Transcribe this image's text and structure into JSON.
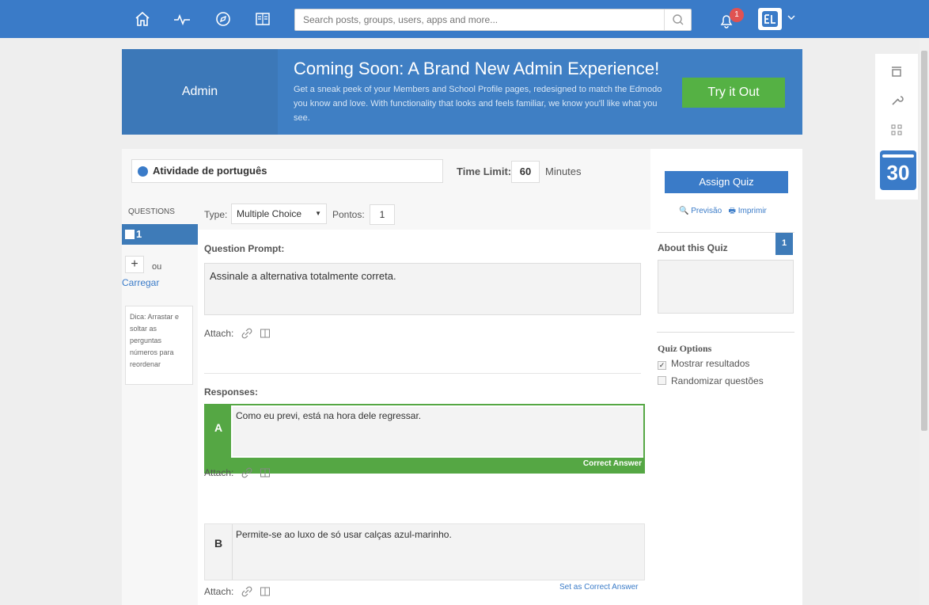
{
  "topbar": {
    "search_placeholder": "Search posts, groups, users, apps and more...",
    "notification_count": "1",
    "icons": [
      "home-icon",
      "activity-icon",
      "discover-icon",
      "library-icon",
      "search-icon",
      "bell-icon",
      "avatar",
      "chevron-down-icon"
    ]
  },
  "banner": {
    "left_label": "Admin",
    "title": "Coming Soon: A Brand New Admin Experience!",
    "description": "Get a sneak peek of your Members and School Profile pages, redesigned to match the Edmodo you know and love. With functionality that looks and feels familiar, we know you'll like what you see.",
    "button": "Try it Out"
  },
  "rail": {
    "icons": [
      "store-icon",
      "wrench-icon",
      "grid-icon"
    ],
    "calendar_day": "30"
  },
  "quiz": {
    "title": "Atividade de português",
    "time_limit_label": "Time Limit:",
    "time_limit_value": "60",
    "time_limit_unit": "Minutes"
  },
  "questions": {
    "header": "QUESTIONS",
    "items": [
      "1"
    ],
    "add_label": "+",
    "or_label": "ou",
    "upload_label": "Carregar",
    "tip": "Dica: Arrastar e soltar as perguntas números para reordenar"
  },
  "editor": {
    "type_label": "Type:",
    "type_value": "Multiple Choice",
    "points_label": "Pontos:",
    "points_value": "1",
    "prompt_label": "Question Prompt:",
    "prompt_text": "Assinale a alternativa totalmente correta.",
    "attach_label": "Attach:",
    "responses_label": "Responses:",
    "responses": [
      {
        "letter": "A",
        "text": "Como eu previ, está na hora dele regressar.",
        "status": "Correct Answer"
      },
      {
        "letter": "B",
        "text": "Permite-se ao luxo de só usar calças azul-marinho.",
        "status": "Set as Correct Answer"
      }
    ]
  },
  "sidebar": {
    "assign_button": "Assign Quiz",
    "preview_link": "Previsão",
    "print_link": "Imprimir",
    "about_label": "About this Quiz",
    "about_count": "1",
    "options_label": "Quiz Options",
    "options": [
      {
        "label": "Mostrar resultados",
        "checked": true
      },
      {
        "label": "Randomizar questões",
        "checked": false
      }
    ]
  },
  "colors": {
    "primary": "#3a7bc8",
    "correct": "#55a744",
    "banner": "#3f7fc4",
    "badge": "#e05252"
  }
}
